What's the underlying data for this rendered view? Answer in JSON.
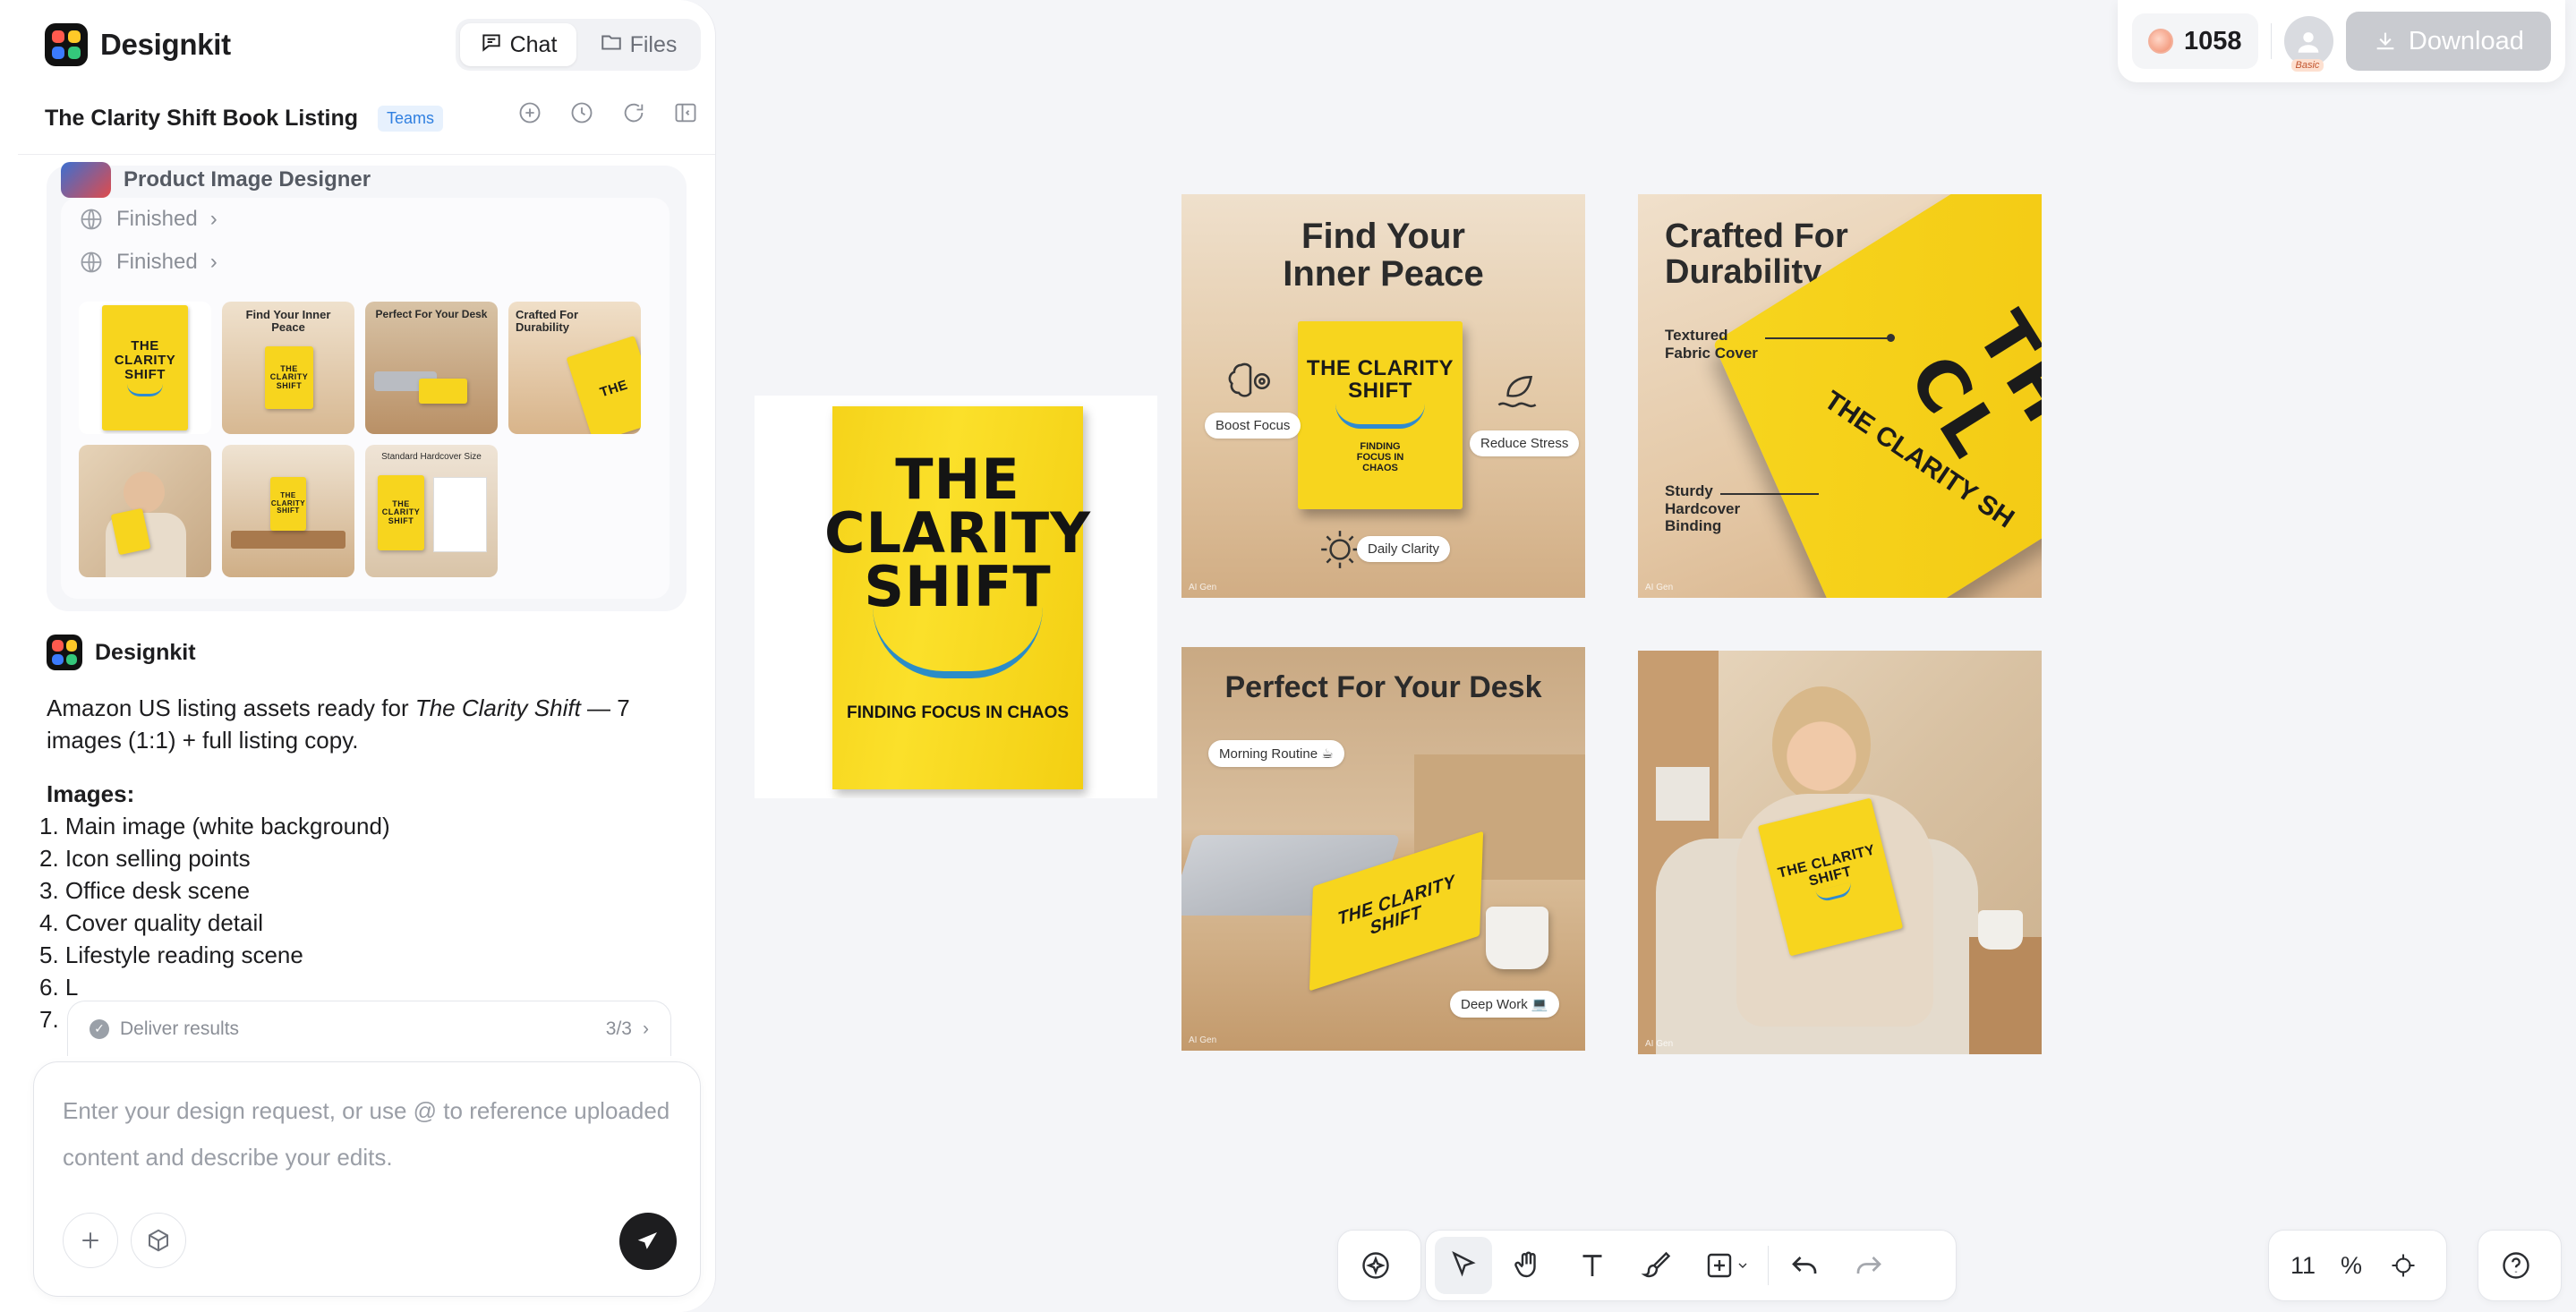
{
  "app": {
    "name": "Designkit"
  },
  "header": {
    "tabs": [
      {
        "label": "Chat",
        "icon": "chat-icon",
        "active": true
      },
      {
        "label": "Files",
        "icon": "folder-icon",
        "active": false
      }
    ],
    "project_title": "The Clarity Shift Book Listing",
    "project_badge": "Teams"
  },
  "agent_card": {
    "name": "Product Image Designer",
    "steps": [
      {
        "status": "Finished"
      },
      {
        "status": "Finished"
      }
    ],
    "thumbnails": [
      {
        "title": "",
        "book": "THE CLARITY SHIFT"
      },
      {
        "title": "Find Your Inner Peace",
        "book": "THE CLARITY SHIFT"
      },
      {
        "title": "Perfect For Your Desk",
        "book": "THE CLARITY SHIFT"
      },
      {
        "title": "Crafted For Durability",
        "book": "THE"
      },
      {
        "title": "",
        "book": "THE CLARITY SHIFT"
      },
      {
        "title": "",
        "book": "THE CLARITY SHIFT"
      },
      {
        "title": "Standard Hardcover Size",
        "book": "THE CLARITY SHIFT"
      }
    ]
  },
  "message": {
    "author": "Designkit",
    "intro_prefix": "Amazon US listing assets ready for ",
    "intro_italic": "The Clarity Shift",
    "intro_suffix": " — 7 images (1:1) + full listing copy.",
    "images_heading": "Images:",
    "images": [
      "1. Main image (white background)",
      "2. Icon selling points",
      "3. Office desk scene",
      "4. Cover quality detail",
      "5. Lifestyle reading scene",
      "6. L",
      "7."
    ]
  },
  "task": {
    "label": "Deliver results",
    "count": "3/3"
  },
  "composer": {
    "placeholder": "Enter your design request, or use @ to reference uploaded content and describe your edits."
  },
  "topbar": {
    "credits": "1058",
    "plan": "Basic",
    "download_label": "Download"
  },
  "canvas": {
    "main_book": {
      "title": "THE CLARITY SHIFT",
      "subtitle": "FINDING FOCUS IN CHAOS"
    },
    "img2": {
      "title": "Find Your Inner Peace",
      "book": "THE CLARITY SHIFT",
      "book_sub": "FINDING FOCUS IN CHAOS",
      "labels": [
        "Boost Focus",
        "Reduce Stress",
        "Daily Clarity"
      ]
    },
    "img3": {
      "title": "Crafted For Durability",
      "labels": [
        "Textured Fabric Cover",
        "Sturdy Hardcover Binding"
      ],
      "spine": "THE CLARITY SH",
      "cover": "TH CL"
    },
    "img4": {
      "title": "Perfect For Your Desk",
      "labels": [
        "Morning Routine ☕",
        "Deep Work 💻"
      ],
      "book": "THE CLARITY SHIFT"
    },
    "img5": {
      "book": "THE CLARITY SHIFT"
    },
    "watermark": "AI Gen"
  },
  "toolbar": {
    "zoom_value": "11",
    "zoom_unit": "%"
  },
  "colors": {
    "accent": "#2f7fe0",
    "book_yellow": "#f7d51e",
    "smile_blue": "#2b8cc7"
  }
}
